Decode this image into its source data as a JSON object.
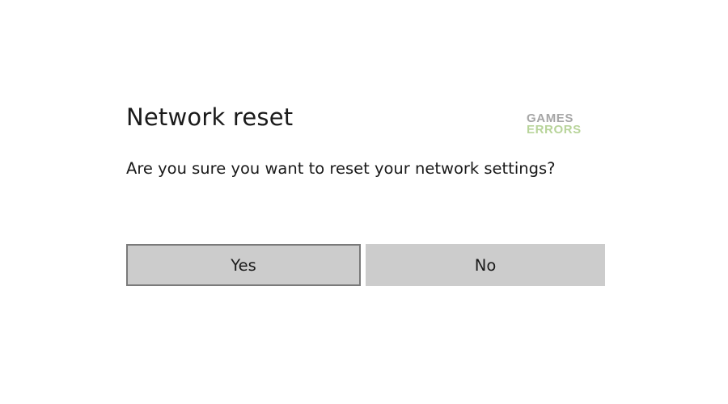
{
  "dialog": {
    "title": "Network reset",
    "message": "Are you sure you want to reset your network settings?",
    "buttons": {
      "yes_label": "Yes",
      "no_label": "No"
    }
  },
  "watermark": {
    "line1": "GAMES",
    "line2": "ERRORS",
    "colors": {
      "line1": "#a6a6a6",
      "line2": "#b8d49a"
    }
  },
  "colors": {
    "background": "#ffffff",
    "text": "#1a1a1a",
    "button_fill": "#cccccc",
    "focused_button_border": "#7a7a7a"
  }
}
